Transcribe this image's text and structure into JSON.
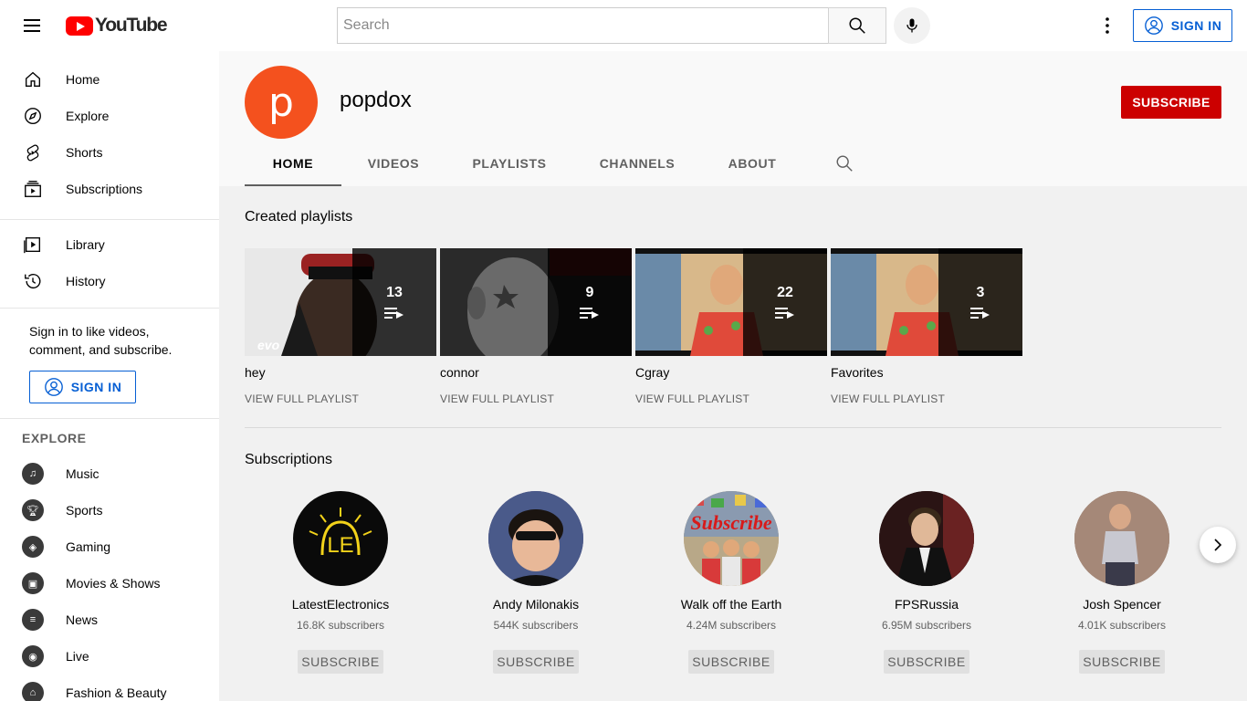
{
  "masthead": {
    "logo_text": "YouTube",
    "search_placeholder": "Search",
    "signin_label": "SIGN IN"
  },
  "sidebar": {
    "main": [
      {
        "label": "Home",
        "icon": "home-icon"
      },
      {
        "label": "Explore",
        "icon": "compass-icon"
      },
      {
        "label": "Shorts",
        "icon": "shorts-icon"
      },
      {
        "label": "Subscriptions",
        "icon": "subscriptions-icon"
      }
    ],
    "library": [
      {
        "label": "Library",
        "icon": "library-icon"
      },
      {
        "label": "History",
        "icon": "history-icon"
      }
    ],
    "promo_text": "Sign in to like videos, comment, and subscribe.",
    "signin_label": "SIGN IN",
    "explore_heading": "EXPLORE",
    "explore": [
      {
        "label": "Music",
        "icon": "music-icon"
      },
      {
        "label": "Sports",
        "icon": "trophy-icon"
      },
      {
        "label": "Gaming",
        "icon": "gaming-icon"
      },
      {
        "label": "Movies & Shows",
        "icon": "film-icon"
      },
      {
        "label": "News",
        "icon": "news-icon"
      },
      {
        "label": "Live",
        "icon": "live-icon"
      },
      {
        "label": "Fashion & Beauty",
        "icon": "hanger-icon"
      }
    ]
  },
  "channel": {
    "avatar_letter": "p",
    "name": "popdox",
    "subscribe_label": "SUBSCRIBE",
    "tabs": [
      "HOME",
      "VIDEOS",
      "PLAYLISTS",
      "CHANNELS",
      "ABOUT"
    ],
    "active_tab": "HOME"
  },
  "playlists_section": {
    "title": "Created playlists",
    "items": [
      {
        "title": "hey",
        "count": "13",
        "link": "VIEW FULL PLAYLIST",
        "badge": "evo"
      },
      {
        "title": "connor",
        "count": "9",
        "link": "VIEW FULL PLAYLIST"
      },
      {
        "title": "Cgray",
        "count": "22",
        "link": "VIEW FULL PLAYLIST"
      },
      {
        "title": "Favorites",
        "count": "3",
        "link": "VIEW FULL PLAYLIST"
      }
    ]
  },
  "subscriptions_section": {
    "title": "Subscriptions",
    "items": [
      {
        "name": "LatestElectronics",
        "subscribers": "16.8K subscribers",
        "button": "SUBSCRIBE",
        "avatar_text": "LE"
      },
      {
        "name": "Andy Milonakis",
        "subscribers": "544K subscribers",
        "button": "SUBSCRIBE"
      },
      {
        "name": "Walk off the Earth",
        "subscribers": "4.24M subscribers",
        "button": "SUBSCRIBE",
        "avatar_text": "Subscribe"
      },
      {
        "name": "FPSRussia",
        "subscribers": "6.95M subscribers",
        "button": "SUBSCRIBE"
      },
      {
        "name": "Josh Spencer",
        "subscribers": "4.01K subscribers",
        "button": "SUBSCRIBE"
      }
    ]
  },
  "colors": {
    "brand_red": "#ff0000",
    "subscribe_red": "#cc0000",
    "link_blue": "#065fd4",
    "avatar_orange": "#f4511e"
  }
}
